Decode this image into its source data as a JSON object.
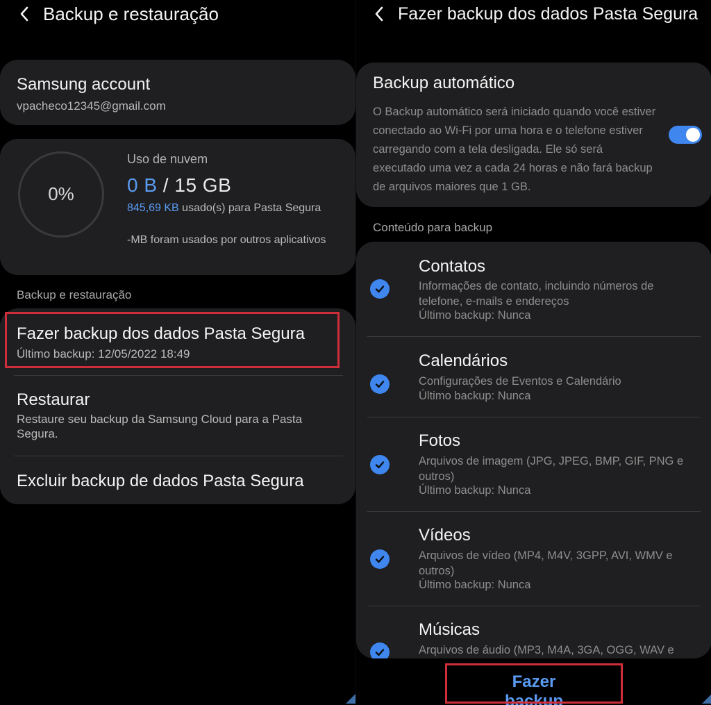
{
  "left": {
    "title": "Backup e restauração",
    "account": {
      "name": "Samsung account",
      "email": "vpacheco12345@gmail.com"
    },
    "storage": {
      "percent_label": "0%",
      "percent_value": 0,
      "cloud_title": "Uso de nuvem",
      "used": "0 B",
      "separator": " / ",
      "total": "15 GB",
      "used_size": "845,69 KB",
      "used_text": " usado(s) para Pasta Segura",
      "others_text": "-MB foram usados por outros aplicativos"
    },
    "section_label": "Backup e restauração",
    "menu": [
      {
        "title": "Fazer backup dos dados Pasta Segura",
        "subtitle": "Último backup: 12/05/2022 18:49"
      },
      {
        "title": "Restaurar",
        "subtitle": "Restaure seu backup da Samsung Cloud para a Pasta Segura."
      },
      {
        "title": "Excluir backup de dados Pasta Segura",
        "subtitle": ""
      }
    ]
  },
  "right": {
    "title": "Fazer backup dos dados Pasta Segura",
    "auto_backup": {
      "title": "Backup automático",
      "description": "O Backup automático será iniciado quando você estiver conectado ao Wi-Fi por uma hora e o telefone estiver carregando com a tela desligada. Ele só será executado uma vez a cada 24 horas e não fará backup de arquivos maiores que 1 GB.",
      "enabled": true
    },
    "section_label": "Conteúdo para backup",
    "items": [
      {
        "title": "Contatos",
        "description": "Informações de contato, incluindo números de telefone, e-mails e endereços",
        "last_backup": "Último backup: Nunca",
        "checked": true
      },
      {
        "title": "Calendários",
        "description": "Configurações de Eventos e Calendário",
        "last_backup": "Último backup: Nunca",
        "checked": true
      },
      {
        "title": "Fotos",
        "description": "Arquivos de imagem (JPG, JPEG, BMP, GIF, PNG e outros)",
        "last_backup": "Último backup: Nunca",
        "checked": true
      },
      {
        "title": "Vídeos",
        "description": "Arquivos de vídeo (MP4, M4V, 3GPP, AVI, WMV e outros)",
        "last_backup": "Último backup: Nunca",
        "checked": true
      },
      {
        "title": "Músicas",
        "description": "Arquivos de áudio (MP3, M4A, 3GA, OGG, WAV e",
        "last_backup": "",
        "checked": true
      }
    ],
    "action_button": "Fazer backup"
  },
  "colors": {
    "accent": "#3f86ef",
    "link": "#5a9bf2",
    "highlight": "#d02d3b",
    "card": "#1f1f21",
    "background": "#000000"
  }
}
